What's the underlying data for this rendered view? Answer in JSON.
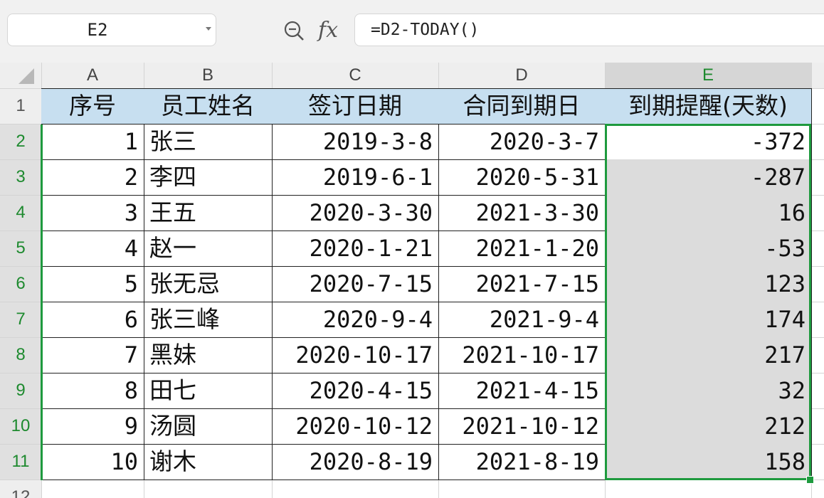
{
  "name_box": {
    "value": "E2"
  },
  "formula": {
    "fx_label": "fx",
    "text": "=D2-TODAY()"
  },
  "columns": [
    "A",
    "B",
    "C",
    "D",
    "E"
  ],
  "row_numbers": [
    "1",
    "2",
    "3",
    "4",
    "5",
    "6",
    "7",
    "8",
    "9",
    "10",
    "11",
    "12"
  ],
  "table": {
    "headers": [
      "序号",
      "员工姓名",
      "签订日期",
      "合同到期日",
      "到期提醒(天数)"
    ],
    "rows": [
      [
        "1",
        "张三",
        "2019-3-8",
        "2020-3-7",
        "-372"
      ],
      [
        "2",
        "李四",
        "2019-6-1",
        "2020-5-31",
        "-287"
      ],
      [
        "3",
        "王五",
        "2020-3-30",
        "2021-3-30",
        "16"
      ],
      [
        "4",
        "赵一",
        "2020-1-21",
        "2021-1-20",
        "-53"
      ],
      [
        "5",
        "张无忌",
        "2020-7-15",
        "2021-7-15",
        "123"
      ],
      [
        "6",
        "张三峰",
        "2020-9-4",
        "2021-9-4",
        "174"
      ],
      [
        "7",
        "黑妹",
        "2020-10-17",
        "2021-10-17",
        "217"
      ],
      [
        "8",
        "田七",
        "2020-4-15",
        "2021-4-15",
        "32"
      ],
      [
        "9",
        "汤圆",
        "2020-10-12",
        "2021-10-12",
        "212"
      ],
      [
        "10",
        "谢木",
        "2020-8-19",
        "2021-8-19",
        "158"
      ]
    ]
  },
  "colors": {
    "selection": "#1e9a3e",
    "header_fill": "#c7dff0",
    "selected_fill": "#dcdcdc"
  }
}
